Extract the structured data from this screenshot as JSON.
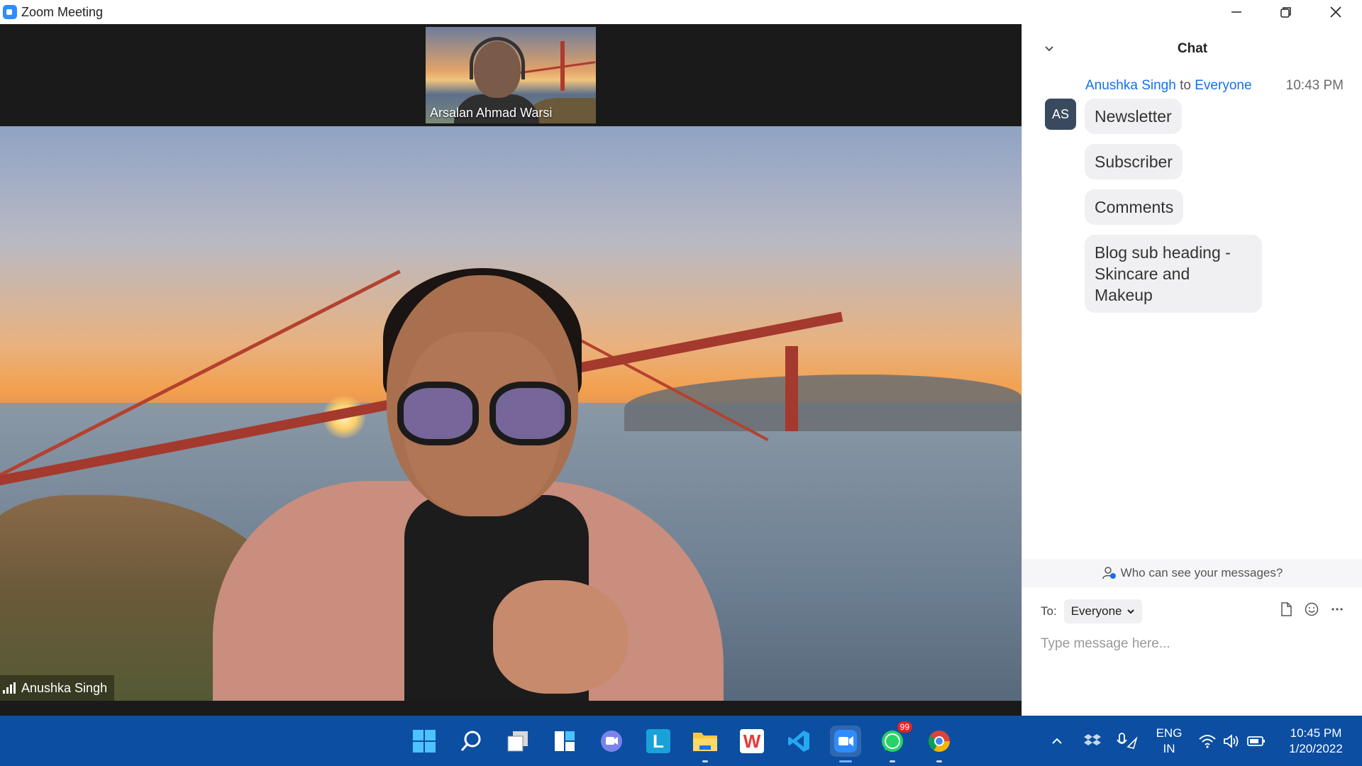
{
  "window": {
    "title": "Zoom Meeting",
    "minimize_icon": "minimize-icon",
    "maximize_icon": "restore-icon",
    "close_icon": "close-icon"
  },
  "video": {
    "thumbnail": {
      "name": "Arsalan Ahmad Warsi"
    },
    "main": {
      "name": "Anushka Singh",
      "signal_icon": "signal-bars-icon"
    }
  },
  "chat": {
    "title": "Chat",
    "collapse_icon": "chevron-down-icon",
    "message_group": {
      "sender": "Anushka Singh",
      "connector": "to",
      "recipient": "Everyone",
      "time": "10:43 PM",
      "avatar_initials": "AS",
      "messages": [
        "Newsletter",
        "Subscriber",
        "Comments",
        "Blog sub heading - Skincare and Makeup"
      ]
    },
    "privacy_text": "Who can see your messages?",
    "to_label": "To:",
    "to_value": "Everyone",
    "input_placeholder": "Type message here...",
    "tools": [
      "file-icon",
      "emoji-icon",
      "more-icon"
    ]
  },
  "taskbar": {
    "apps": [
      {
        "name": "start",
        "icon": "windows-start-icon"
      },
      {
        "name": "search",
        "icon": "search-icon"
      },
      {
        "name": "task-view",
        "icon": "task-view-icon"
      },
      {
        "name": "widgets",
        "icon": "widgets-icon"
      },
      {
        "name": "teams-chat",
        "icon": "chat-icon"
      },
      {
        "name": "l-app",
        "icon": "l-app-icon",
        "label": "L"
      },
      {
        "name": "file-explorer",
        "icon": "folder-icon"
      },
      {
        "name": "wps-office",
        "icon": "wps-icon",
        "label": "W"
      },
      {
        "name": "vs-code",
        "icon": "vscode-icon"
      },
      {
        "name": "zoom",
        "icon": "zoom-icon"
      },
      {
        "name": "whatsapp",
        "icon": "whatsapp-icon",
        "badge": "99"
      },
      {
        "name": "chrome",
        "icon": "chrome-icon"
      }
    ],
    "tray": {
      "language_line1": "ENG",
      "language_line2": "IN",
      "time": "10:45 PM",
      "date": "1/20/2022"
    }
  }
}
